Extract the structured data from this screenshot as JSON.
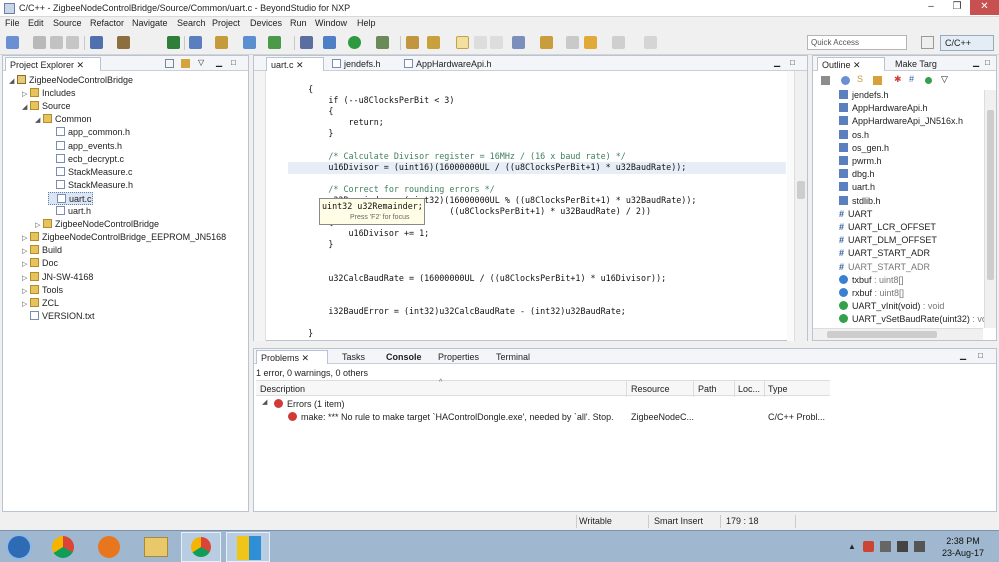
{
  "window": {
    "title": "C/C++ - ZigbeeNodeControlBridge/Source/Common/uart.c - BeyondStudio for NXP",
    "minimize": "–",
    "maximize": "❐",
    "close": "✕"
  },
  "menu": [
    "File",
    "Edit",
    "Source",
    "Refactor",
    "Navigate",
    "Search",
    "Project",
    "Devices",
    "Run",
    "Window",
    "Help"
  ],
  "quick_access": {
    "placeholder": "Quick Access"
  },
  "perspective": {
    "label": "C/C++"
  },
  "project_explorer": {
    "tab_title": "Project Explorer",
    "items": [
      {
        "label": "ZigbeeNodeControlBridge",
        "depth": 0,
        "type": "project",
        "expanded": true
      },
      {
        "label": "Includes",
        "depth": 1,
        "type": "folder",
        "expanded": false
      },
      {
        "label": "Source",
        "depth": 1,
        "type": "folder",
        "expanded": true
      },
      {
        "label": "Common",
        "depth": 2,
        "type": "folder",
        "expanded": true
      },
      {
        "label": "app_common.h",
        "depth": 3,
        "type": "h"
      },
      {
        "label": "app_events.h",
        "depth": 3,
        "type": "h"
      },
      {
        "label": "ecb_decrypt.c",
        "depth": 3,
        "type": "c"
      },
      {
        "label": "StackMeasure.c",
        "depth": 3,
        "type": "c"
      },
      {
        "label": "StackMeasure.h",
        "depth": 3,
        "type": "h"
      },
      {
        "label": "uart.c",
        "depth": 3,
        "type": "c"
      },
      {
        "label": "uart.h",
        "depth": 3,
        "type": "h"
      },
      {
        "label": "ZigbeeNodeControlBridge",
        "depth": 2,
        "type": "folder",
        "expanded": false
      },
      {
        "label": "ZigbeeNodeControlBridge_EEPROM_JN5168",
        "depth": 1,
        "type": "folder",
        "expanded": false
      },
      {
        "label": "Build",
        "depth": 1,
        "type": "folder",
        "expanded": false
      },
      {
        "label": "Doc",
        "depth": 1,
        "type": "folder",
        "expanded": false
      },
      {
        "label": "JN-SW-4168",
        "depth": 1,
        "type": "folder",
        "expanded": false
      },
      {
        "label": "Tools",
        "depth": 1,
        "type": "folder",
        "expanded": false
      },
      {
        "label": "ZCL",
        "depth": 1,
        "type": "folder",
        "expanded": false
      },
      {
        "label": "VERSION.txt",
        "depth": 1,
        "type": "file"
      }
    ]
  },
  "editor": {
    "tabs": [
      {
        "label": "uart.c",
        "active": true
      },
      {
        "label": "jendefs.h"
      },
      {
        "label": "AppHardwareApi.h"
      }
    ],
    "lines": [
      "    {",
      "        if (--u8ClocksPerBit < 3)",
      "        {",
      "            return;",
      "        }",
      "",
      "        /* Calculate Divisor register = 16MHz / (16 x baud rate) */",
      "        u16Divisor = (uint16)(16000000UL / ((u8ClocksPerBit+1) * u32BaudRate));",
      "",
      "        /* Correct for rounding errors */",
      "        u32Remainder = (uint32)(16000000UL % ((u8ClocksPerBit+1) * u32BaudRate));",
      "                                ((u8ClocksPerBit+1) * u32BaudRate) / 2))",
      "        {",
      "            u16Divisor += 1;",
      "        }",
      "",
      "",
      "        u32CalcBaudRate = (16000000UL / ((u8ClocksPerBit+1) * u16Divisor));",
      "",
      "",
      "        i32BaudError = (int32)u32CalcBaudRate - (int32)u32BaudRate;",
      "",
      "    }"
    ],
    "hover": {
      "signature": "uint32 u32Remainder;",
      "hint": "Press 'F2' for focus"
    }
  },
  "outline": {
    "tabs": [
      {
        "label": "Outline",
        "active": true
      },
      {
        "label": "Make Targ"
      }
    ],
    "items": [
      {
        "label": "jendefs.h",
        "kind": "include"
      },
      {
        "label": "AppHardwareApi.h",
        "kind": "include"
      },
      {
        "label": "AppHardwareApi_JN516x.h",
        "kind": "include"
      },
      {
        "label": "os.h",
        "kind": "include"
      },
      {
        "label": "os_gen.h",
        "kind": "include"
      },
      {
        "label": "pwrm.h",
        "kind": "include"
      },
      {
        "label": "dbg.h",
        "kind": "include"
      },
      {
        "label": "uart.h",
        "kind": "include"
      },
      {
        "label": "stdlib.h",
        "kind": "include"
      },
      {
        "label": "UART",
        "kind": "define"
      },
      {
        "label": "UART_LCR_OFFSET",
        "kind": "define"
      },
      {
        "label": "UART_DLM_OFFSET",
        "kind": "define"
      },
      {
        "label": "UART_START_ADR",
        "kind": "define"
      },
      {
        "label": "UART_START_ADR",
        "kind": "define",
        "dim": true
      },
      {
        "label": "txbuf",
        "type": " : uint8[]",
        "kind": "var"
      },
      {
        "label": "rxbuf",
        "type": " : uint8[]",
        "kind": "var"
      },
      {
        "label": "UART_vInit(void)",
        "type": " : void",
        "kind": "fn"
      },
      {
        "label": "UART_vSetBaudRate(uint32)",
        "type": " : void",
        "kind": "fn"
      }
    ]
  },
  "bottom": {
    "tabs": [
      {
        "label": "Problems",
        "active": true
      },
      {
        "label": "Tasks"
      },
      {
        "label": "Console"
      },
      {
        "label": "Properties"
      },
      {
        "label": "Terminal"
      }
    ],
    "summary": "1 error, 0 warnings, 0 others",
    "columns": [
      "Description",
      "Resource",
      "Path",
      "Loc...",
      "Type"
    ],
    "group": "Errors (1 item)",
    "rows": [
      {
        "description": "make: *** No rule to make target `HAControlDongle.exe', needed by `all'.  Stop.",
        "resource": "ZigbeeNodeC...",
        "path": "",
        "location": "",
        "type": "C/C++ Probl..."
      }
    ]
  },
  "status": {
    "mode": "Writable",
    "insert": "Smart Insert",
    "position": "179 : 18"
  },
  "taskbar": {
    "time": "2:38 PM",
    "date": "23-Aug-17"
  }
}
